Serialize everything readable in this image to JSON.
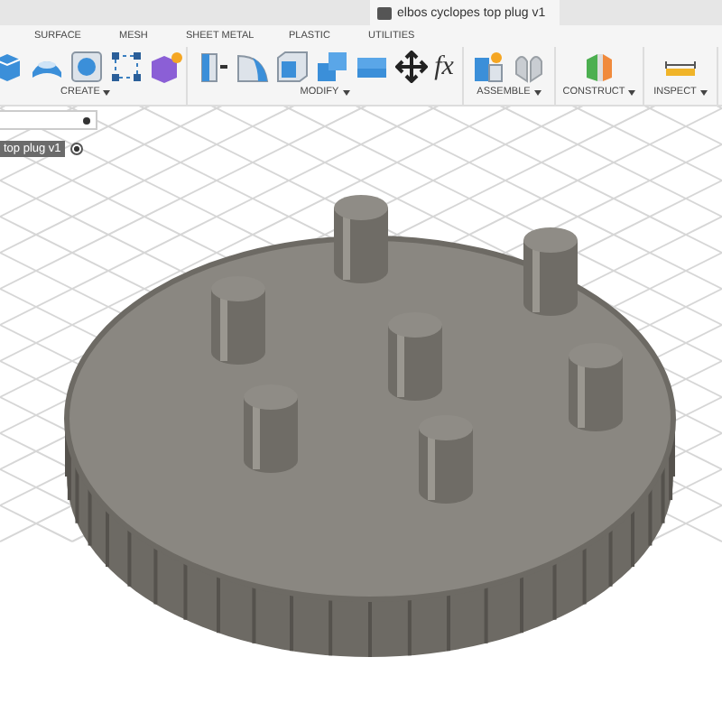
{
  "document_tab": {
    "title": "elbos cyclopes top plug v1"
  },
  "tabs": [
    {
      "label": "SURFACE"
    },
    {
      "label": "MESH"
    },
    {
      "label": "SHEET METAL"
    },
    {
      "label": "PLASTIC"
    },
    {
      "label": "UTILITIES"
    }
  ],
  "toolbar_groups": [
    {
      "label": "CREATE"
    },
    {
      "label": "MODIFY",
      "formula_symbol": "fx"
    },
    {
      "label": "ASSEMBLE"
    },
    {
      "label": "CONSTRUCT"
    },
    {
      "label": "INSPECT"
    }
  ],
  "browser": {
    "item": {
      "label": "top plug v1",
      "selected": true
    }
  }
}
